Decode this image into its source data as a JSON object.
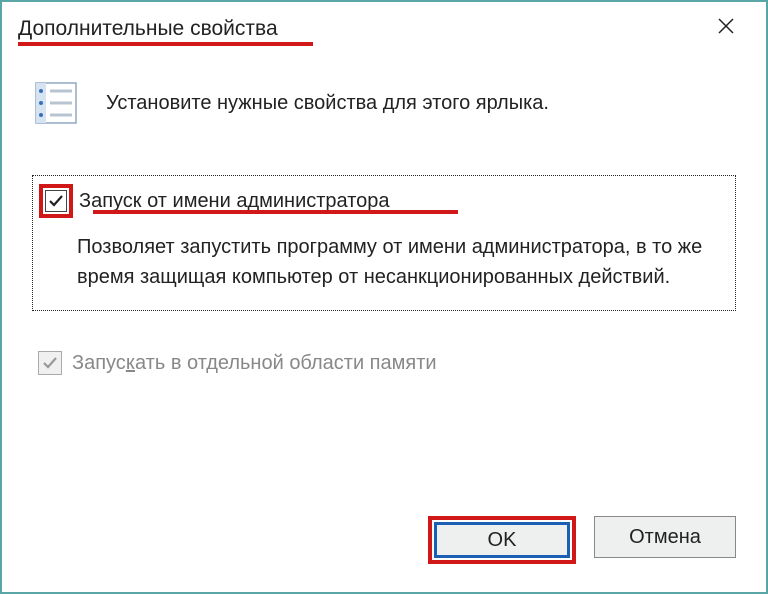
{
  "window": {
    "title": "Дополнительные свойства"
  },
  "instruction": "Установите нужные свойства для этого ярлыка.",
  "option": {
    "label": "Запуск от имени администратора",
    "checked": true,
    "description": "Позволяет запустить программу от имени администратора, в то же время защищая компьютер от несанкционированных действий."
  },
  "disabled_option": {
    "label_prefix": "Запус",
    "label_hotkey": "к",
    "label_suffix": "ать в отдельной области памяти",
    "checked": true
  },
  "buttons": {
    "ok": "OK",
    "cancel": "Отмена"
  }
}
